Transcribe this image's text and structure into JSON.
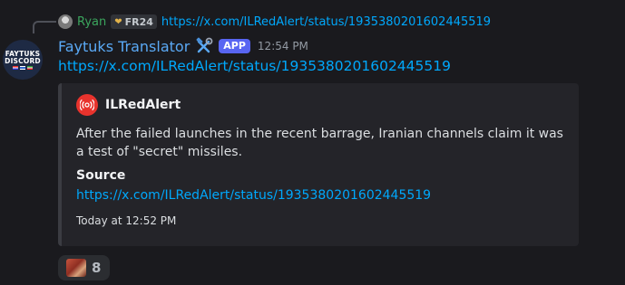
{
  "reply": {
    "username": "Ryan",
    "tag_text": "FR24",
    "link": "https://x.com/ILRedAlert/status/1935380201602445519"
  },
  "avatar": {
    "line1": "FAYTUKS",
    "line2": "DISCORD"
  },
  "message": {
    "author": "Faytuks Translator",
    "app_badge": "APP",
    "timestamp": "12:54 PM",
    "link": "https://x.com/ILRedAlert/status/1935380201602445519"
  },
  "embed": {
    "author_name": "ILRedAlert",
    "description": "After the failed launches in the recent barrage, Iranian channels claim it was a test of \"secret\" missiles.",
    "field_name": "Source",
    "field_value": "https://x.com/ILRedAlert/status/1935380201602445519",
    "footer": "Today at 12:52 PM"
  },
  "reaction": {
    "count": "8"
  },
  "colors": {
    "background": "#1a1a1e",
    "link": "#00a8fc",
    "author_name": "#5aa9f5",
    "app_badge": "#5865f2",
    "reply_name": "#3ba55d",
    "embed_icon": "#e8332d"
  },
  "icons": {
    "reply_avatar": "user-avatar-icon",
    "tag_icon": "heart-icon",
    "bot_icon": "hammer-wrench-icon",
    "embed_author_icon": "red-alert-radar-icon",
    "reaction_emoji": "custom-face-emoji"
  }
}
